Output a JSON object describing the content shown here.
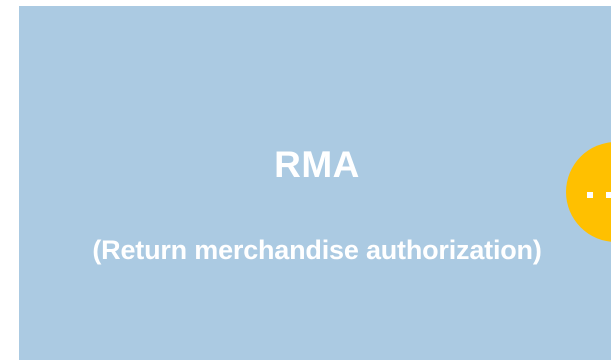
{
  "slide": {
    "title": "RMA",
    "subtitle": "(Return merchandise authorization)"
  },
  "fab": {
    "icon": "more-dots-icon"
  },
  "colors": {
    "card_background": "#abcae2",
    "text": "#ffffff",
    "accent": "#ffc000"
  }
}
